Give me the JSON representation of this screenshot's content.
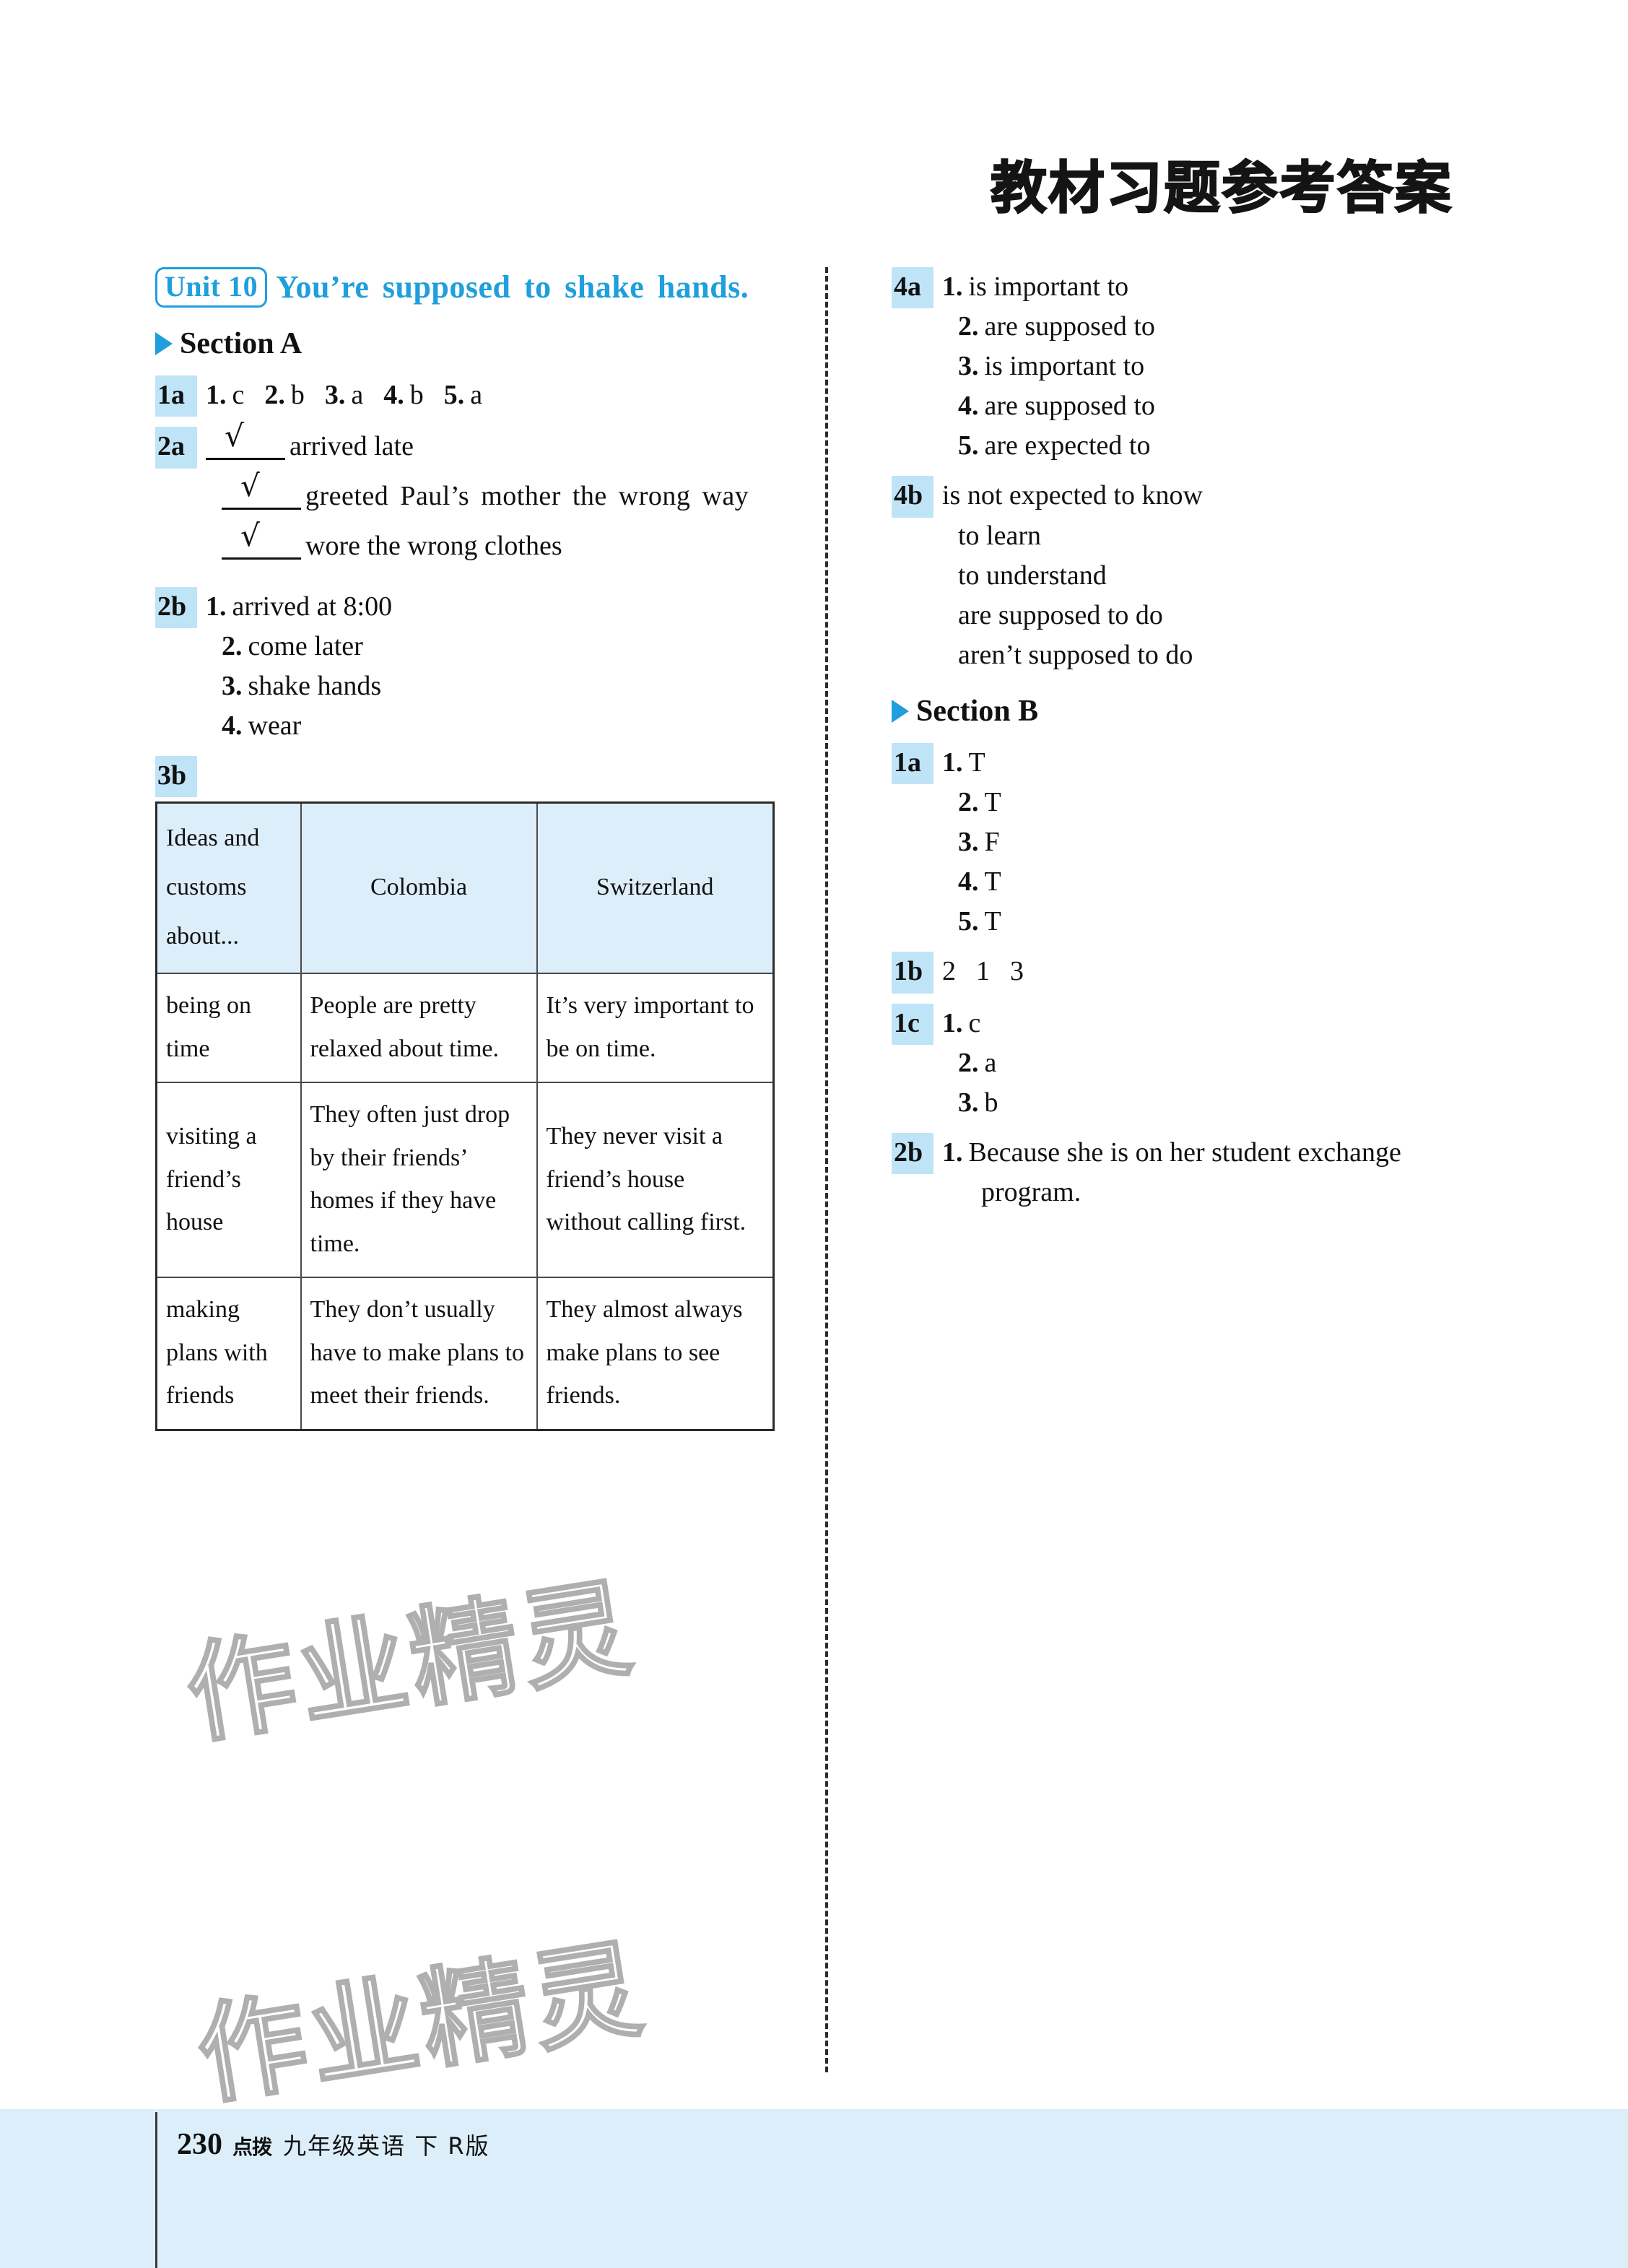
{
  "page": {
    "title": "教材习题参考答案",
    "footer": {
      "page_number": "230",
      "brand": "点拨",
      "meta": "九年级英语 下 R版"
    },
    "watermark": "作业精灵"
  },
  "unit": {
    "badge": "Unit 10",
    "title": "You’re supposed to shake hands."
  },
  "sections": {
    "a": {
      "label": "Section A"
    },
    "b": {
      "label": "Section B"
    }
  },
  "a_1a": {
    "tag": "1a",
    "items": [
      {
        "num": "1.",
        "ans": "c"
      },
      {
        "num": "2.",
        "ans": "b"
      },
      {
        "num": "3.",
        "ans": "a"
      },
      {
        "num": "4.",
        "ans": "b"
      },
      {
        "num": "5.",
        "ans": "a"
      }
    ]
  },
  "a_2a": {
    "tag": "2a",
    "check": "√",
    "items": [
      "arrived late",
      "greeted Paul’s mother the wrong way",
      "wore the wrong clothes"
    ]
  },
  "a_2b": {
    "tag": "2b",
    "items": [
      {
        "num": "1.",
        "ans": "arrived at 8:00"
      },
      {
        "num": "2.",
        "ans": "come later"
      },
      {
        "num": "3.",
        "ans": "shake hands"
      },
      {
        "num": "4.",
        "ans": "wear"
      }
    ]
  },
  "a_3b": {
    "tag": "3b",
    "headers": [
      "Ideas and customs about...",
      "Colombia",
      "Switzerland"
    ],
    "rows": [
      {
        "topic": "being on time",
        "colombia": "People are pretty relaxed about time.",
        "switzerland": "It’s very important to be on time."
      },
      {
        "topic": "visiting a friend’s house",
        "colombia": "They often just drop by their friends’ homes if they have time.",
        "switzerland": "They never visit a friend’s house without calling first."
      },
      {
        "topic": "making plans with friends",
        "colombia": "They don’t usually have to make plans to meet their friends.",
        "switzerland": "They almost always make plans to see friends."
      }
    ]
  },
  "a_4a": {
    "tag": "4a",
    "items": [
      {
        "num": "1.",
        "ans": "is important to"
      },
      {
        "num": "2.",
        "ans": "are supposed to"
      },
      {
        "num": "3.",
        "ans": "is important to"
      },
      {
        "num": "4.",
        "ans": "are supposed to"
      },
      {
        "num": "5.",
        "ans": "are expected to"
      }
    ]
  },
  "a_4b": {
    "tag": "4b",
    "items": [
      "is not expected to know",
      "to learn",
      "to understand",
      "are supposed to do",
      "aren’t supposed to do"
    ]
  },
  "b_1a": {
    "tag": "1a",
    "items": [
      {
        "num": "1.",
        "ans": "T"
      },
      {
        "num": "2.",
        "ans": "T"
      },
      {
        "num": "3.",
        "ans": "F"
      },
      {
        "num": "4.",
        "ans": "T"
      },
      {
        "num": "5.",
        "ans": "T"
      }
    ]
  },
  "b_1b": {
    "tag": "1b",
    "order": [
      "2",
      "1",
      "3"
    ]
  },
  "b_1c": {
    "tag": "1c",
    "items": [
      {
        "num": "1.",
        "ans": "c"
      },
      {
        "num": "2.",
        "ans": "a"
      },
      {
        "num": "3.",
        "ans": "b"
      }
    ]
  },
  "b_2b": {
    "tag": "2b",
    "items": [
      {
        "num": "1.",
        "ans": "Because she is on her student exchange program."
      }
    ]
  }
}
